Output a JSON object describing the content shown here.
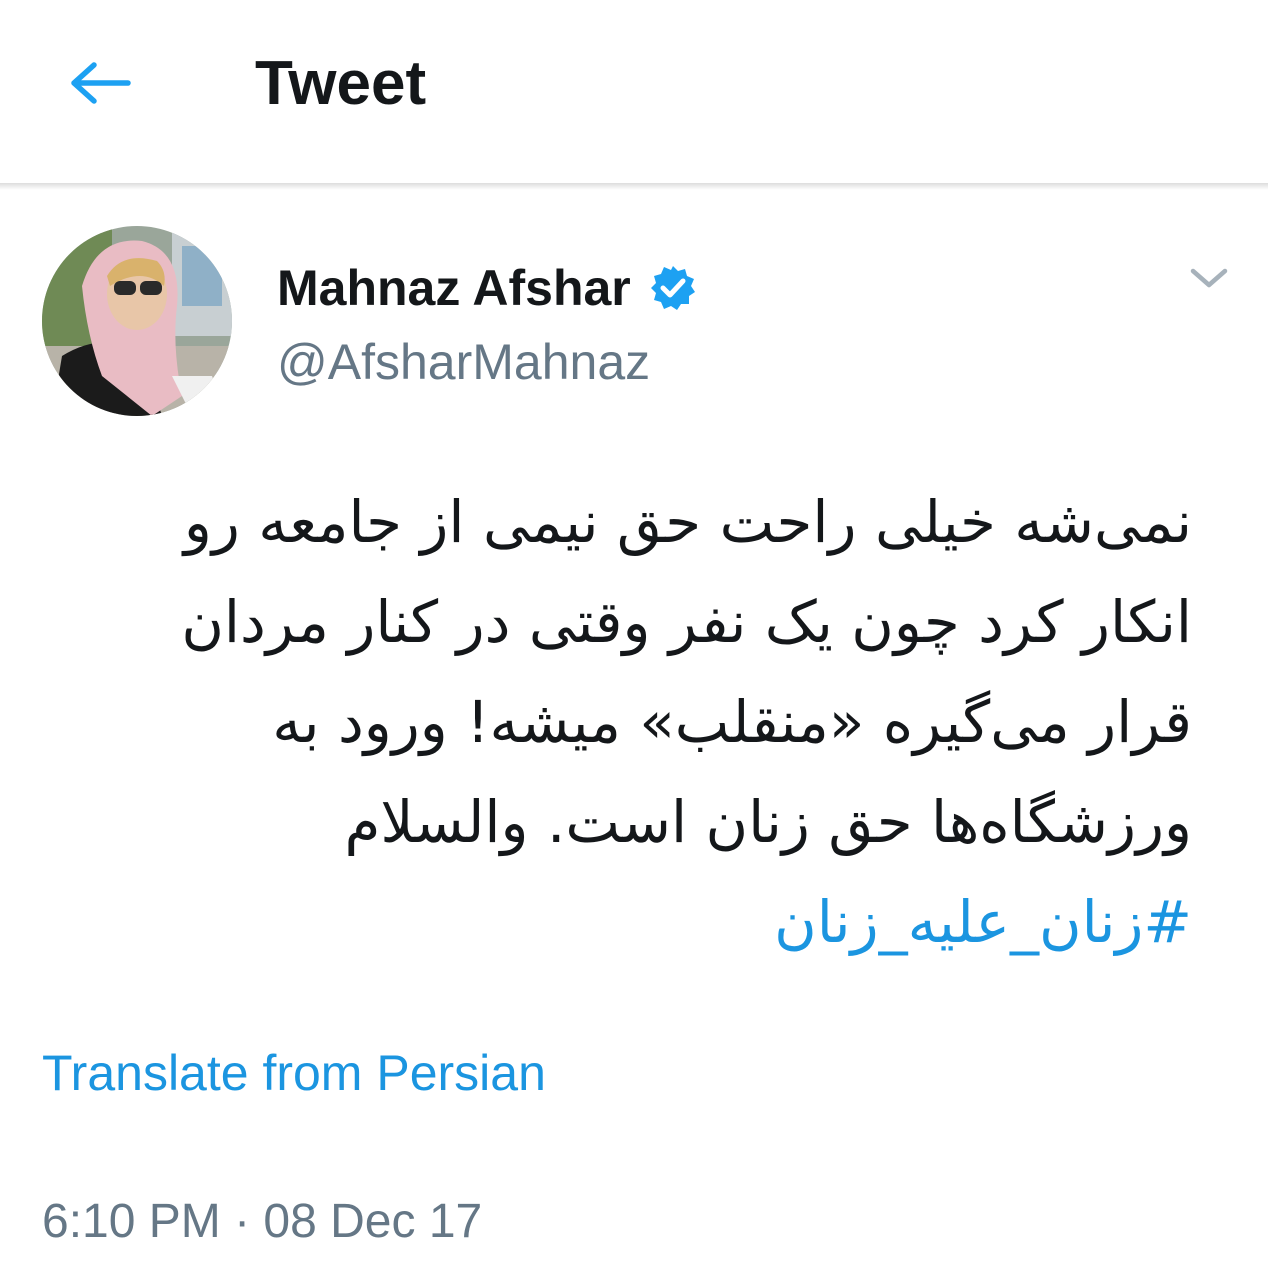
{
  "header": {
    "title": "Tweet",
    "back_icon": "arrow-left-icon",
    "accent_color": "#1da1f2"
  },
  "author": {
    "display_name": "Mahnaz Afshar",
    "handle": "@AfsharMahnaz",
    "verified": true,
    "verified_icon": "verified-badge-icon",
    "avatar_icon": "profile-avatar"
  },
  "tweet": {
    "lines": [
      "نمی‌شه خیلی راحت حق نیمی از جامعه رو",
      "انکار کرد چون یک نفر وقتی در کنار مردان",
      "قرار می‌گیره «منقلب» میشه! ورود به",
      "ورزشگاه‌ها حق زنان است. والسلام"
    ],
    "hashtag": "#زنان_علیه_زنان",
    "hashtag_color": "#1b95e0",
    "translate_label": "Translate from Persian",
    "timestamp": "6:10 PM · 08 Dec 17",
    "menu_icon": "chevron-down-icon"
  }
}
